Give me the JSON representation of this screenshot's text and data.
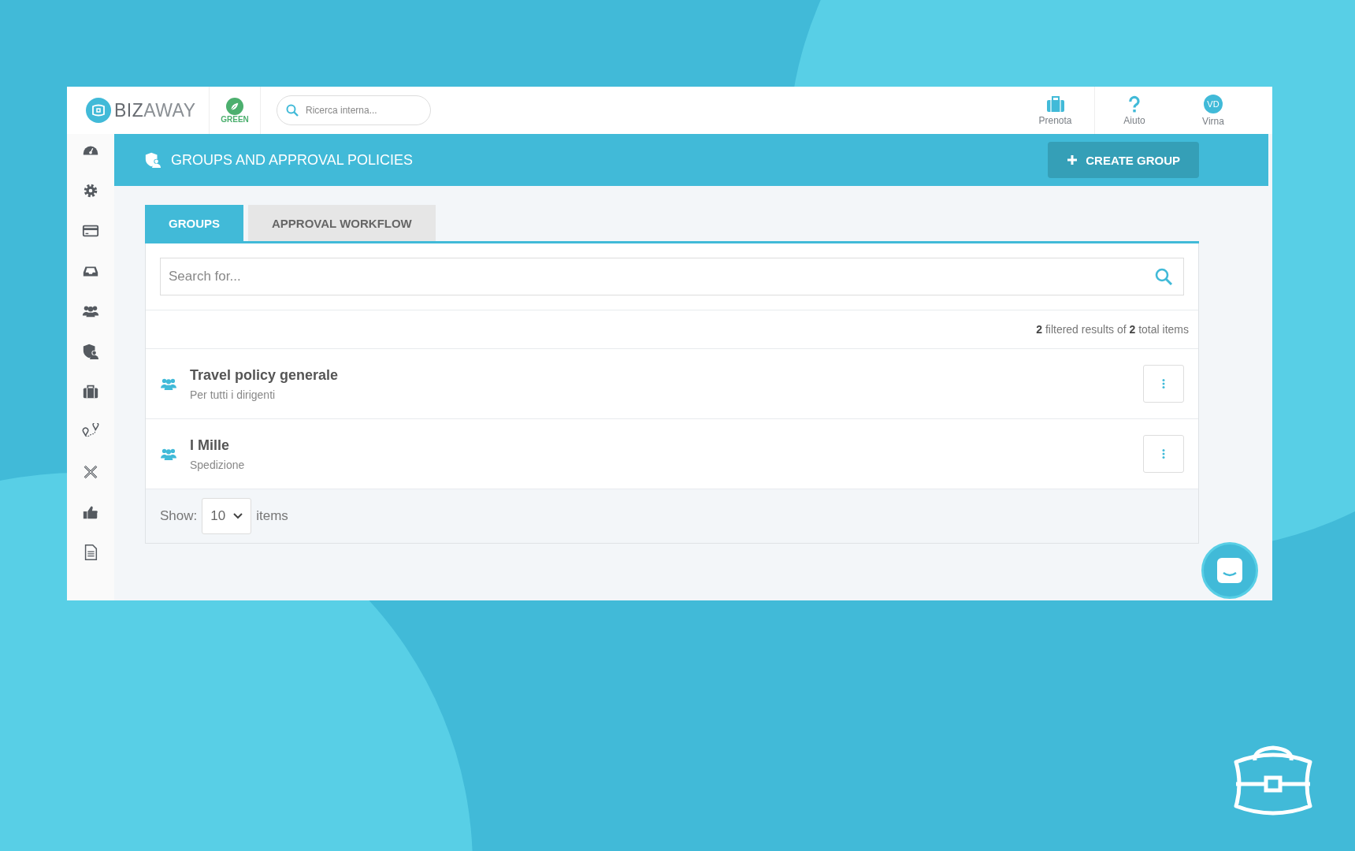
{
  "brand": {
    "name": "**BIZ**AWAY"
  },
  "green_badge": {
    "label": "GREEN"
  },
  "top_search": {
    "placeholder": "Ricerca interna..."
  },
  "top_actions": [
    {
      "kind": "briefcase",
      "label": "Prenota"
    },
    {
      "kind": "help",
      "label": "Aiuto"
    },
    {
      "kind": "avatar",
      "initials": "VD",
      "label": "Virna"
    }
  ],
  "page_header": {
    "title": "GROUPS AND APPROVAL POLICIES",
    "button": "CREATE GROUP"
  },
  "tabs": [
    {
      "label": "GROUPS",
      "selected": true
    },
    {
      "label": "APPROVAL WORKFLOW",
      "selected": false
    }
  ],
  "search": {
    "placeholder": "Search for..."
  },
  "results_summary": "**2** filtered results of **2** total items",
  "groups": [
    {
      "name": "Travel policy generale",
      "description": "Per tutti i dirigenti"
    },
    {
      "name": "I Mille",
      "description": "Spedizione"
    }
  ],
  "pagination": {
    "label": "Show:",
    "page_size": "10",
    "suffix": "items"
  }
}
